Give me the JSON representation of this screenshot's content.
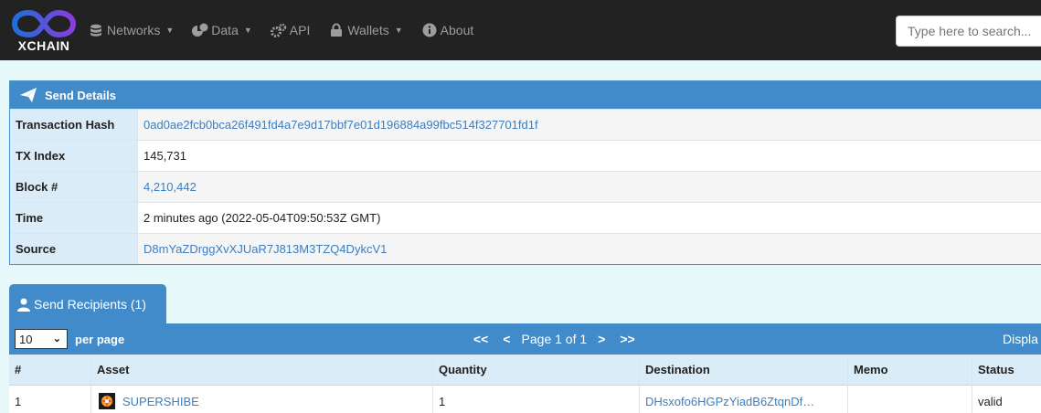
{
  "nav": {
    "brand": "XCHAIN",
    "items": [
      {
        "label": "Networks",
        "icon": "database-icon",
        "caret": true
      },
      {
        "label": "Data",
        "icon": "chart-icon",
        "caret": true
      },
      {
        "label": "API",
        "icon": "gears-icon",
        "caret": false
      },
      {
        "label": "Wallets",
        "icon": "lock-icon",
        "caret": true
      },
      {
        "label": "About",
        "icon": "info-icon",
        "caret": false
      }
    ],
    "search_placeholder": "Type here to search..."
  },
  "send_details": {
    "title": "Send Details",
    "rows": [
      {
        "key": "Transaction Hash",
        "value": "0ad0ae2fcb0bca26f491fd4a7e9d17bbf7e01d196884a99fbc514f327701fd1f",
        "link": true
      },
      {
        "key": "TX Index",
        "value": "145,731",
        "link": false
      },
      {
        "key": "Block #",
        "value": "4,210,442",
        "link": true
      },
      {
        "key": "Time",
        "value": "2 minutes ago (2022-05-04T09:50:53Z GMT)",
        "link": false
      },
      {
        "key": "Source",
        "value": "D8mYaZDrggXvXJUaR7J813M3TZQ4DykcV1",
        "link": true
      }
    ]
  },
  "recipients": {
    "tab_label": "Send Recipients (1)",
    "per_page_value": "10",
    "per_page_label": "per page",
    "pager": {
      "first": "<<",
      "prev": "<",
      "page_text": "Page 1 of 1",
      "next": ">",
      "last": ">>"
    },
    "display_text": "Displa",
    "columns": [
      "#",
      "Asset",
      "Quantity",
      "Destination",
      "Memo",
      "Status"
    ],
    "rows": [
      {
        "num": "1",
        "asset": "SUPERSHIBE",
        "quantity": "1",
        "destination": "DHsxofo6HGPzYiadB6ZtqnDf…",
        "memo": "",
        "status": "valid"
      }
    ]
  },
  "colors": {
    "accent": "#428bca",
    "navbar": "#222222",
    "link": "#3c7ec0",
    "header_cell": "#d9ecf7"
  }
}
